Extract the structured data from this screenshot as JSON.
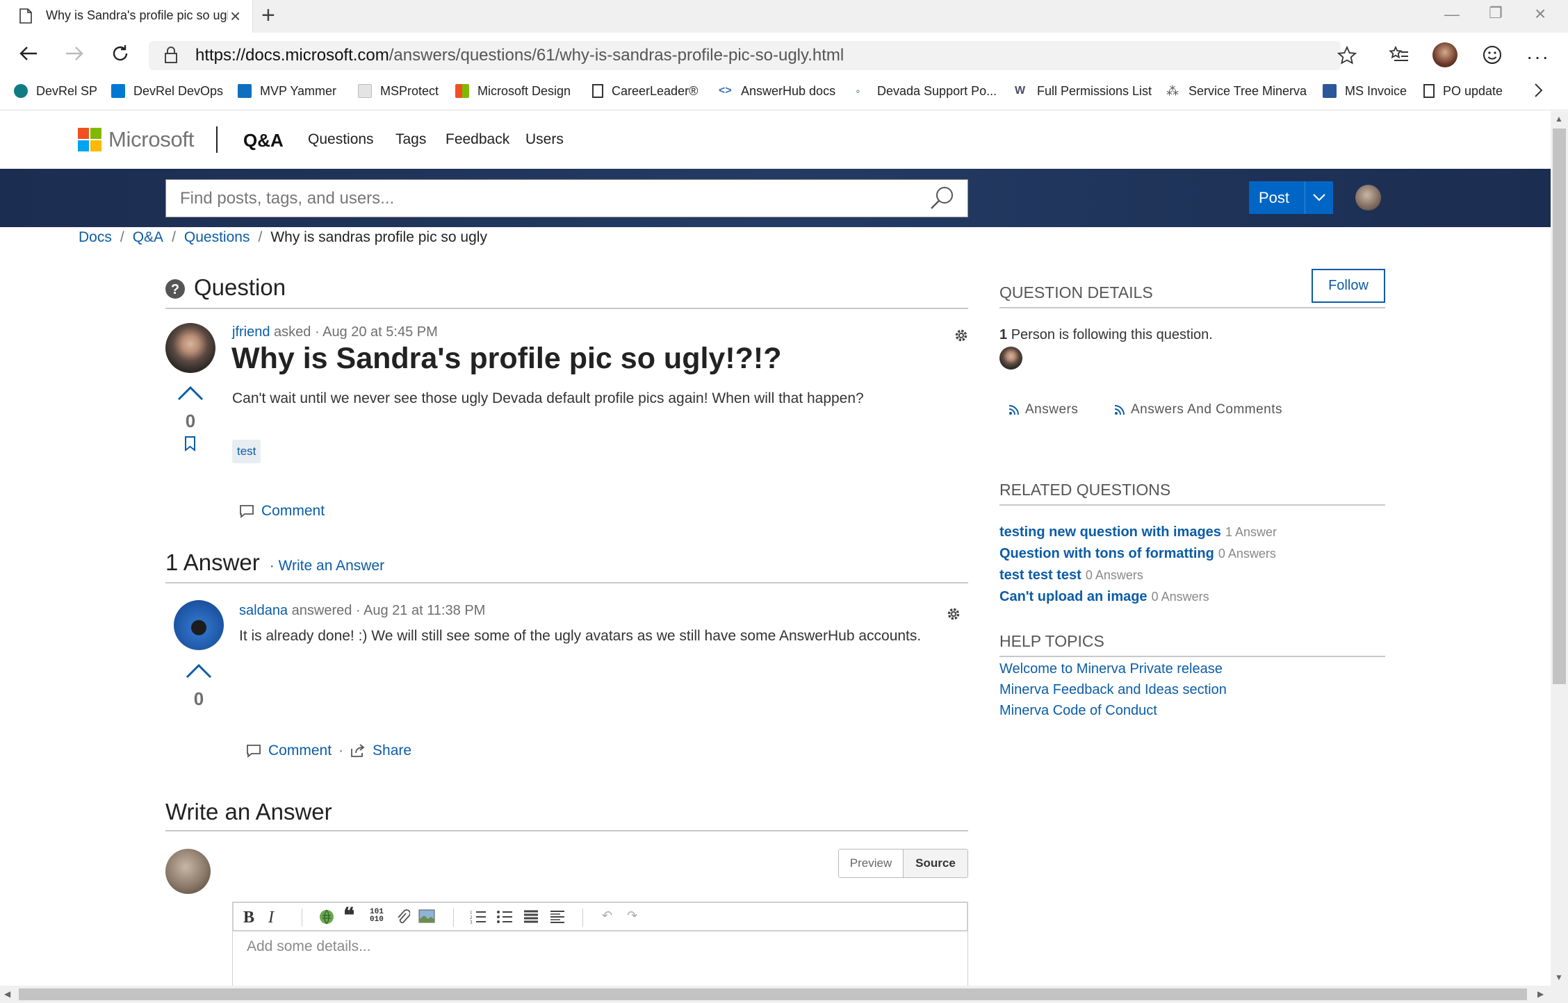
{
  "browser": {
    "tab_title": "Why is Sandra's profile pic so ugly!?!? - Microsoft Q&A",
    "url_prefix": "https://docs.microsoft.com",
    "url_path": "/answers/questions/61/why-is-sandras-profile-pic-so-ugly.html",
    "favorites": [
      {
        "label": "DevRel SP",
        "icon": "sharepoint-icon",
        "color": "#0f7b83"
      },
      {
        "label": "DevRel DevOps",
        "icon": "devops-icon",
        "color": "#0078d4"
      },
      {
        "label": "MVP Yammer",
        "icon": "yammer-icon",
        "color": "#106ebe"
      },
      {
        "label": "MSProtect",
        "icon": "page-icon",
        "color": "#b0b0b0"
      },
      {
        "label": "Microsoft Design",
        "icon": "microsoft-icon",
        "color": "#f25022"
      },
      {
        "label": "CareerLeader®",
        "icon": "document-icon",
        "color": "#ffffff"
      },
      {
        "label": "AnswerHub docs",
        "icon": "code-icon",
        "color": "#3a6fb0"
      },
      {
        "label": "Devada Support Po...",
        "icon": "dots-icon",
        "color": "#5b7fa6"
      },
      {
        "label": "Full Permissions List",
        "icon": "w-icon",
        "color": "#4a4a6a"
      },
      {
        "label": "Service Tree Minerva",
        "icon": "tree-icon",
        "color": "#555"
      },
      {
        "label": "MS Invoice",
        "icon": "invoice-icon",
        "color": "#2b579a"
      },
      {
        "label": "PO update",
        "icon": "document-icon",
        "color": "#ffffff"
      }
    ]
  },
  "header": {
    "brand": "Microsoft",
    "section": "Q&A",
    "nav": [
      "Questions",
      "Tags",
      "Feedback",
      "Users"
    ],
    "search_placeholder": "Find posts, tags, and users...",
    "post_label": "Post"
  },
  "breadcrumb": [
    "Docs",
    "Q&A",
    "Questions",
    "Why is sandras profile pic so ugly"
  ],
  "question": {
    "section_label": "Question",
    "author": "jfriend",
    "action": "asked",
    "date": "· Aug 20 at 5:45 PM",
    "title": "Why is Sandra's profile pic so ugly!?!?",
    "body": "Can't wait until we never see those ugly Devada default profile pics again! When will that happen?",
    "votes": "0",
    "tag": "test",
    "comment_label": "Comment"
  },
  "answers": {
    "count_label": "1 Answer",
    "write_link": "· Write an Answer",
    "items": [
      {
        "author": "saldana",
        "action": "answered",
        "date": "· Aug 21 at 11:38 PM",
        "body": "It is already done! :) We will still see some of the ugly avatars as we still have some AnswerHub accounts.",
        "votes": "0",
        "comment_label": "Comment",
        "share_label": "Share"
      }
    ]
  },
  "write_answer": {
    "heading": "Write an Answer",
    "preview_label": "Preview",
    "source_label": "Source",
    "placeholder": "Add some details..."
  },
  "sidebar": {
    "details_heading": "QUESTION DETAILS",
    "follow_label": "Follow",
    "following_count": "1",
    "following_text": "Person is following this question.",
    "rss_answers": "Answers",
    "rss_answers_comments": "Answers And Comments",
    "related_heading": "RELATED QUESTIONS",
    "related": [
      {
        "title": "testing new question with images",
        "count": "1 Answer"
      },
      {
        "title": "Question with tons of formatting",
        "count": "0 Answers"
      },
      {
        "title": "test test test",
        "count": "0 Answers"
      },
      {
        "title": "Can't upload an image",
        "count": "0 Answers"
      }
    ],
    "help_heading": "HELP TOPICS",
    "help": [
      "Welcome to Minerva Private release",
      "Minerva Feedback and Ideas section",
      "Minerva Code of Conduct"
    ]
  },
  "colors": {
    "accent": "#0066c5",
    "link": "#0b5ca7",
    "band": "#1b2d50"
  }
}
